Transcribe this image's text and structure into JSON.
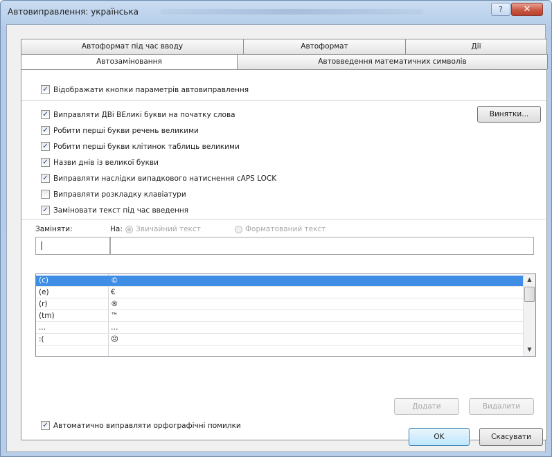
{
  "window": {
    "title": "Автовиправлення: українська",
    "help_glyph": "?",
    "close_glyph": "✕"
  },
  "tabs": {
    "back": [
      "Автоформат під час вводу",
      "Автоформат",
      "Дії"
    ],
    "front": [
      "Автозаміновання",
      "Автовведення математичних символів"
    ],
    "active": "Автозаміновання"
  },
  "checks": [
    {
      "label": "Відображати кнопки параметрів автовиправлення",
      "checked": true
    },
    {
      "label": "Виправляти ДВі ВЕликі букви на початку слова",
      "checked": true
    },
    {
      "label": "Робити перші букви речень великими",
      "checked": true
    },
    {
      "label": "Робити перші букви клітинок таблиць великими",
      "checked": true
    },
    {
      "label": "Назви днів із великої букви",
      "checked": true
    },
    {
      "label": "Виправляти наслідки випадкового натиснення сAPS LOCK",
      "checked": true
    },
    {
      "label": "Виправляти розкладку клавіатури",
      "checked": false
    },
    {
      "label": "Заміновати текст під час введення",
      "checked": true
    }
  ],
  "exceptions_button": "Винятки...",
  "replace": {
    "replace_label": "Заміняти:",
    "with_label": "На:",
    "radio_plain": "Звичайний текст",
    "radio_formatted": "Форматований текст",
    "replace_value": "|",
    "with_value": ""
  },
  "list": {
    "rows": [
      {
        "from": "(c)",
        "to": "©",
        "selected": true
      },
      {
        "from": "(e)",
        "to": "€",
        "selected": false
      },
      {
        "from": "(r)",
        "to": "®",
        "selected": false
      },
      {
        "from": "(tm)",
        "to": "™",
        "selected": false
      },
      {
        "from": "...",
        "to": "…",
        "selected": false
      },
      {
        "from": ":(",
        "to": "☹",
        "selected": false
      }
    ],
    "scroll_up": "▲",
    "scroll_down": "▼"
  },
  "buttons": {
    "add": "Додати",
    "delete": "Видалити",
    "ok": "OK",
    "cancel": "Скасувати"
  },
  "auto_spell": {
    "label": "Автоматично виправляти орфографічні помилки",
    "checked": true
  }
}
